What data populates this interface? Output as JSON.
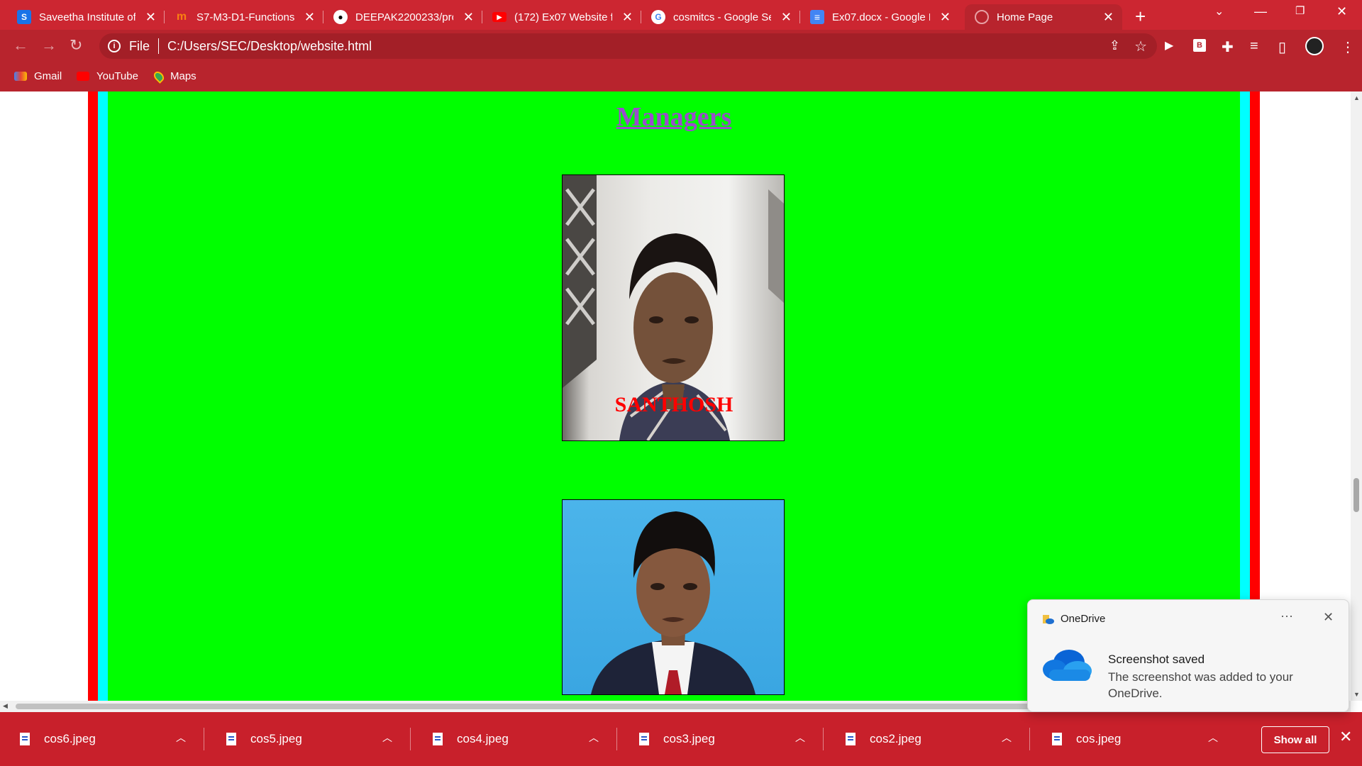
{
  "browser": {
    "tabs": [
      {
        "label": "Saveetha Institute of T",
        "icon": "saveetha-icon",
        "active": false
      },
      {
        "label": "S7-M3-D1-Functions",
        "icon": "moodle-icon",
        "active": false
      },
      {
        "label": "DEEPAK2200233/prod",
        "icon": "github-icon",
        "active": false
      },
      {
        "label": "(172) Ex07 Website fo",
        "icon": "youtube-icon",
        "active": false
      },
      {
        "label": "cosmitcs - Google Sea",
        "icon": "google-icon",
        "active": false
      },
      {
        "label": "Ex07.docx - Google D",
        "icon": "docs-icon",
        "active": false
      },
      {
        "label": "Home Page",
        "icon": "globe-icon",
        "active": true
      }
    ],
    "address": {
      "scheme": "File",
      "url": "C:/Users/SEC/Desktop/website.html"
    },
    "bookmarks": [
      {
        "label": "Gmail",
        "icon": "gmail-icon"
      },
      {
        "label": "YouTube",
        "icon": "youtube-icon"
      },
      {
        "label": "Maps",
        "icon": "maps-icon"
      }
    ],
    "colors": {
      "chrome": "#cc2631",
      "toolbar": "#b8242d"
    }
  },
  "page": {
    "heading": "Managers",
    "people": [
      {
        "name": "SANTHOSH"
      },
      {
        "name": ""
      }
    ],
    "colors": {
      "background": "#00ff00",
      "outer_border": "#ff0000",
      "inner_border": "#00ffff",
      "heading": "#9a4ccc",
      "name": "#ff0000"
    }
  },
  "downloads": {
    "items": [
      "cos6.jpeg",
      "cos5.jpeg",
      "cos4.jpeg",
      "cos3.jpeg",
      "cos2.jpeg",
      "cos.jpeg"
    ],
    "show_all": "Show all"
  },
  "notification": {
    "app": "OneDrive",
    "title": "Screenshot saved",
    "body": "The screenshot was added to your OneDrive."
  }
}
